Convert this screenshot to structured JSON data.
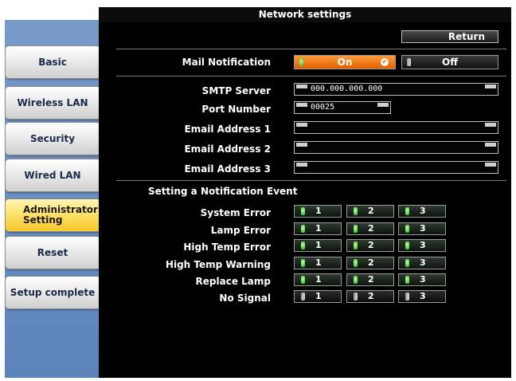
{
  "window": {
    "title": "Network settings"
  },
  "sidebar": {
    "items": [
      {
        "label": "Basic",
        "active": false
      },
      {
        "label": "Wireless LAN",
        "active": false
      },
      {
        "label": "Security",
        "active": false
      },
      {
        "label": "Wired LAN",
        "active": false
      },
      {
        "label": "Administrator Setting",
        "line1": "Administrator",
        "line2": "Setting",
        "active": true
      },
      {
        "label": "Reset",
        "active": false
      },
      {
        "label": "Setup complete",
        "active": false
      }
    ]
  },
  "header": {
    "return_label": "Return"
  },
  "mail_notification": {
    "label": "Mail Notification",
    "on_label": "On",
    "off_label": "Off",
    "selected": "On"
  },
  "fields": {
    "smtp_server": {
      "label": "SMTP Server",
      "value": "000.000.000.000"
    },
    "port_number": {
      "label": "Port Number",
      "value": "00025"
    },
    "email1": {
      "label": "Email Address 1",
      "value": ""
    },
    "email2": {
      "label": "Email Address 2",
      "value": ""
    },
    "email3": {
      "label": "Email Address 3",
      "value": ""
    }
  },
  "events": {
    "section_title": "Setting a Notification Event",
    "rows": [
      {
        "label": "System Error",
        "states": [
          true,
          true,
          true
        ]
      },
      {
        "label": "Lamp Error",
        "states": [
          true,
          true,
          true
        ]
      },
      {
        "label": "High Temp Error",
        "states": [
          true,
          true,
          true
        ]
      },
      {
        "label": "High Temp Warning",
        "states": [
          true,
          true,
          true
        ]
      },
      {
        "label": "Replace Lamp",
        "states": [
          true,
          true,
          true
        ]
      },
      {
        "label": "No Signal",
        "states": [
          false,
          false,
          false
        ]
      }
    ],
    "column_labels": [
      "1",
      "2",
      "3"
    ]
  },
  "colors": {
    "accent_on": "#e06000",
    "active_tab": "#ffe066",
    "sidebar_bg": "#6a90c2",
    "panel_bg": "#000000",
    "lamp_on": "#2fb52a",
    "lamp_off": "#bdbdbd"
  }
}
